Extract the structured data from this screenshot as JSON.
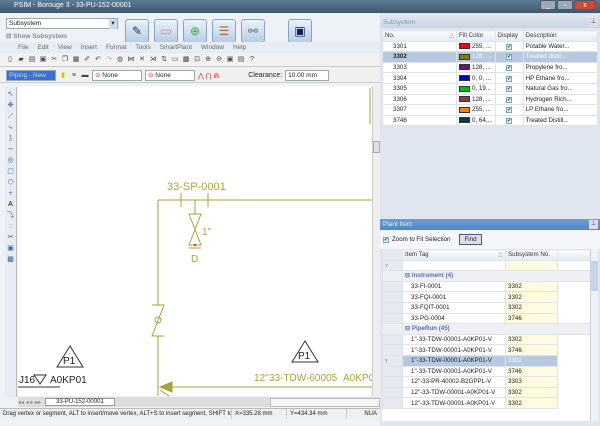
{
  "window": {
    "title": "PSIM - Borouge 3 - 33-PU-152-00001",
    "controls": [
      "_",
      "▫",
      "x"
    ]
  },
  "top": {
    "subsystem_select": "Subsystem",
    "show_subsystem": "Show Subsystem",
    "big_buttons": [
      {
        "name": "pen",
        "glyph": "✎"
      },
      {
        "name": "eraser",
        "glyph": "⌫"
      },
      {
        "name": "tag-add",
        "glyph": "⊕"
      },
      {
        "name": "list",
        "glyph": "☰"
      },
      {
        "name": "link",
        "glyph": "⚯"
      },
      {
        "name": "save",
        "glyph": "💾"
      }
    ]
  },
  "menu": [
    "File",
    "Edit",
    "View",
    "Insert",
    "Format",
    "Tools",
    "SmartPlant",
    "Window",
    "Help"
  ],
  "toolbar2": {
    "layer_select": "Piping - New",
    "line_select1": "None",
    "line_select2": "None",
    "clearance_label": "Clearance:",
    "clearance_value": "10.00 mm"
  },
  "drawing": {
    "color": "#a9a23e",
    "labels": {
      "sp": "33-SP-0001",
      "size": "1\"",
      "d": "D",
      "p1a": "P1",
      "p1b": "P1",
      "line_size": "12\"",
      "line_tag": "33-TDW-60005",
      "line_suffix": "A0KP0",
      "left_tag": "J16",
      "left_suffix": "A0KP01"
    }
  },
  "tabs": {
    "active": "33-PU-152-00001"
  },
  "status": {
    "message": "Drag vertex or segment, ALT to insert/move vertex, ALT+S to insert segment, SHIFT to sp",
    "x": "X=335.28 mm",
    "y": "Y=434.34 mm",
    "mode": "NUA"
  },
  "subsystem_panel": {
    "title": "Subsystem",
    "columns": [
      "No.",
      "Fill Color",
      "Display",
      "Description"
    ],
    "rows": [
      {
        "no": "3301",
        "color": "#ff0000",
        "fill": "255, ...",
        "desc": "Potable Water..."
      },
      {
        "no": "3302",
        "color": "#808000",
        "fill": "128, ...",
        "desc": "Treated distil...",
        "selected": true
      },
      {
        "no": "3303",
        "color": "#800080",
        "fill": "128, ...",
        "desc": "Propylene fro..."
      },
      {
        "no": "3304",
        "color": "#0000c0",
        "fill": "0, 0, ...",
        "desc": "HP Ethane fro..."
      },
      {
        "no": "3305",
        "color": "#00c000",
        "fill": "0, 19...",
        "desc": "Natural Gas fro..."
      },
      {
        "no": "3306",
        "color": "#804040",
        "fill": "128, ...",
        "desc": "Hydrogen Rich..."
      },
      {
        "no": "3307",
        "color": "#ff8000",
        "fill": "255, ...",
        "desc": "LP Ethane fro..."
      },
      {
        "no": "3746",
        "color": "#004040",
        "fill": "0, 64,...",
        "desc": "Treated Distill..."
      }
    ]
  },
  "plant_panel": {
    "title": "Plant Item",
    "zoom_label": "Zoom to Fit Selection",
    "find": "Find",
    "columns": [
      "Item Tag",
      "Subsystem No."
    ],
    "groups": [
      {
        "label": "Instrument (4)",
        "rows": [
          [
            "33-FI-0001",
            "3302"
          ],
          [
            "33-FQI-0001",
            "3302"
          ],
          [
            "33-FQIT-0001",
            "3302"
          ],
          [
            "33-PG-0004",
            "3746"
          ]
        ]
      },
      {
        "label": "PipeRun (45)",
        "rows": [
          [
            "1\"-33-TDW-00001-A0KP01-V",
            "3302"
          ],
          [
            "1\"-33-TDW-00001-A0KP01-V",
            "3746"
          ],
          [
            "1\"-33-TDW-00001-A0KP01-V",
            "3302"
          ],
          [
            "1\"-33-TDW-00001-A0KP01-V",
            "3746"
          ],
          [
            "12\"-33-PR-40002-B2GPPL-V",
            "3303"
          ],
          [
            "12\"-33-TDW-00001-A0KP01-V",
            "3302"
          ],
          [
            "12\"-33-TDW-00001-A0KP01-V",
            "3302"
          ]
        ]
      }
    ],
    "selected_pipe_index": 2
  }
}
